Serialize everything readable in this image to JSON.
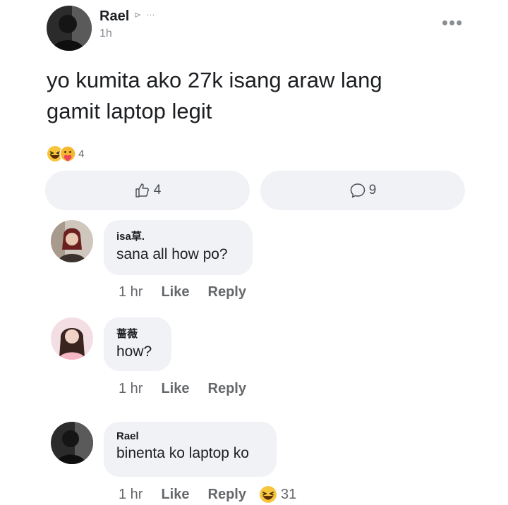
{
  "post": {
    "author": "Rael",
    "author_extra": "⊳ ⋯",
    "time": "1h",
    "text_line1": "yo kumita ako 27k isang araw lang",
    "text_line2": "gamit laptop legit",
    "reaction_count": "4",
    "like_count": "4",
    "comment_count": "9",
    "more_glyph": "•••"
  },
  "comments": [
    {
      "author": "isa草.",
      "text": "sana all how po?",
      "time": "1 hr",
      "like": "Like",
      "reply": "Reply"
    },
    {
      "author": "蔷薇",
      "text": "how?",
      "time": "1 hr",
      "like": "Like",
      "reply": "Reply"
    },
    {
      "author": "Rael",
      "text": "binenta ko laptop ko",
      "time": "1 hr",
      "like": "Like",
      "reply": "Reply",
      "reaction_count": "31"
    }
  ],
  "colors": {
    "pill_bg": "#f0f2f5",
    "muted": "#65676b",
    "text": "#1c1e21"
  },
  "icons": [
    "like-thumb-icon",
    "comment-bubble-icon",
    "haha-emoji-icon",
    "care-emoji-icon",
    "more-options-icon"
  ]
}
